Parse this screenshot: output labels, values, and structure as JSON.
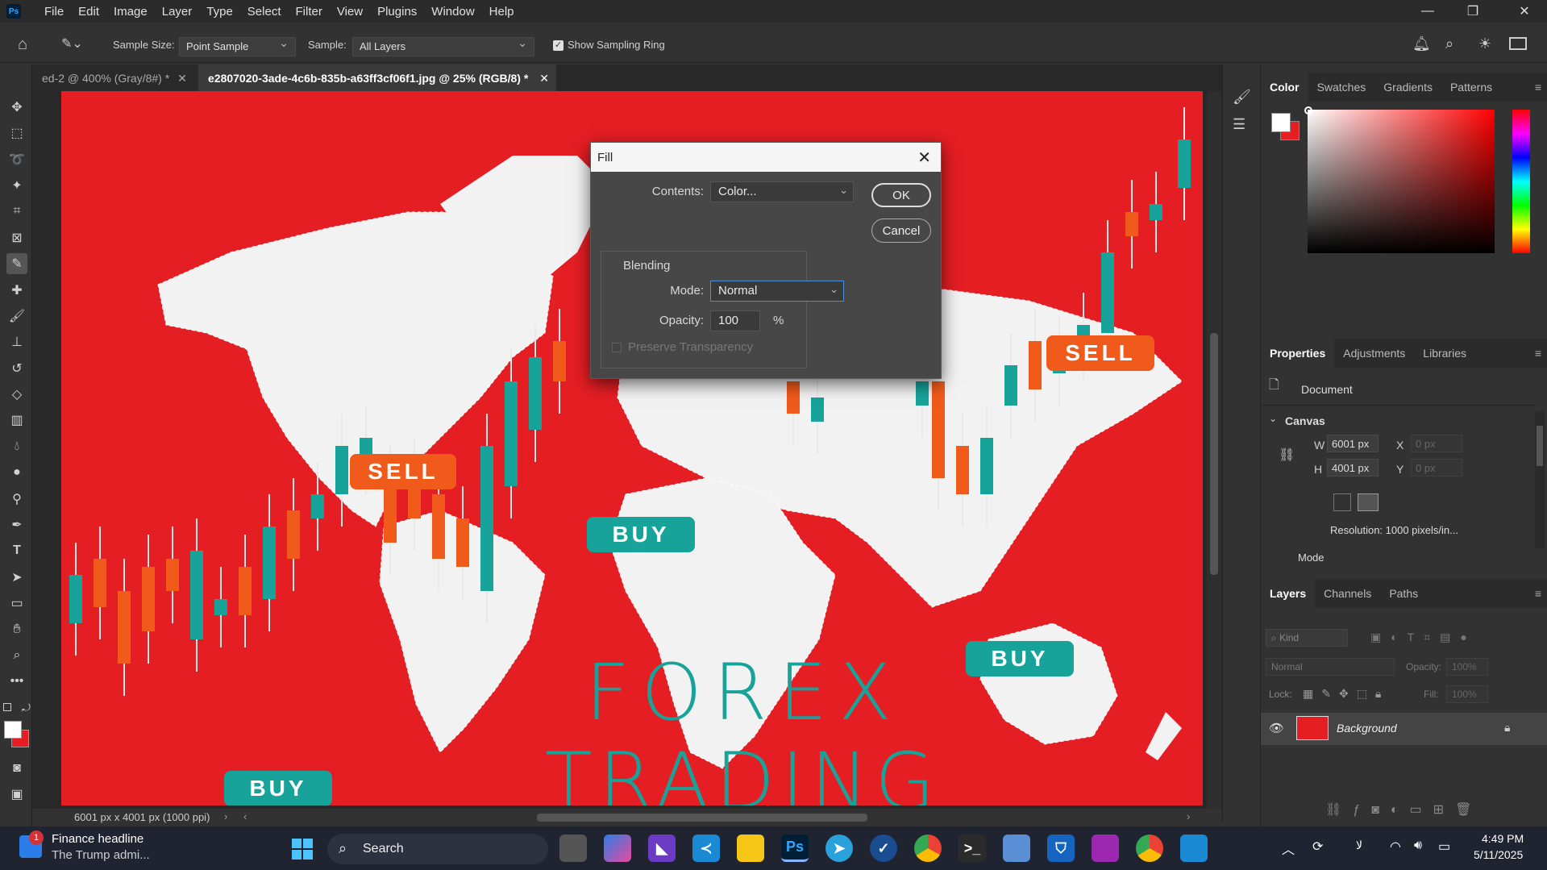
{
  "app": {
    "logo": "Ps",
    "menu": [
      "File",
      "Edit",
      "Image",
      "Layer",
      "Type",
      "Select",
      "Filter",
      "View",
      "Plugins",
      "Window",
      "Help"
    ]
  },
  "options": {
    "sample_size_label": "Sample Size:",
    "sample_size_value": "Point Sample",
    "sample_label": "Sample:",
    "sample_value": "All Layers",
    "show_ring_label": "Show Sampling Ring",
    "show_ring_checked": true
  },
  "tabs": [
    {
      "label": "ed-2 @ 400% (Gray/8#) *",
      "active": false
    },
    {
      "label": "e2807020-3ade-4c6b-835b-a63ff3cf06f1.jpg @ 25% (RGB/8) *",
      "active": true
    }
  ],
  "artwork": {
    "sell_1": "SELL",
    "sell_2": "SELL",
    "buy_1": "BUY",
    "buy_2": "BUY",
    "buy_3": "BUY",
    "headline_1": "FOREX",
    "headline_2": "TRADING"
  },
  "fill_dialog": {
    "title": "Fill",
    "contents_label": "Contents:",
    "contents_value": "Color...",
    "ok": "OK",
    "cancel": "Cancel",
    "blending_title": "Blending",
    "mode_label": "Mode:",
    "mode_value": "Normal",
    "opacity_label": "Opacity:",
    "opacity_value": "100",
    "opacity_unit": "%",
    "preserve_label": "Preserve Transparency",
    "preserve_checked": false
  },
  "color_panel": {
    "tabs": [
      "Color",
      "Swatches",
      "Gradients",
      "Patterns"
    ],
    "foreground": "#ffffff",
    "background": "#e51e24"
  },
  "properties_panel": {
    "tabs": [
      "Properties",
      "Adjustments",
      "Libraries"
    ],
    "doc_label": "Document",
    "canvas_label": "Canvas",
    "w_label": "W",
    "w_value": "6001 px",
    "h_label": "H",
    "h_value": "4001 px",
    "x_label": "X",
    "x_placeholder": "0 px",
    "y_label": "Y",
    "y_placeholder": "0 px",
    "resolution": "Resolution: 1000 pixels/in...",
    "mode_label": "Mode"
  },
  "layers_panel": {
    "tabs": [
      "Layers",
      "Channels",
      "Paths"
    ],
    "kind_placeholder": "Kind",
    "blend_mode": "Normal",
    "opacity_label": "Opacity:",
    "opacity_value": "100%",
    "lock_label": "Lock:",
    "fill_label": "Fill:",
    "fill_value": "100%",
    "layers": [
      {
        "name": "Background",
        "visible": true,
        "locked": true
      }
    ]
  },
  "status": {
    "doc_info": "6001 px x 4001 px (1000 ppi)"
  },
  "taskbar": {
    "news_badge": "1",
    "news_title": "Finance headline",
    "news_subtitle": "The Trump admi...",
    "search_label": "Search",
    "time": "4:49 PM",
    "date": "5/11/2025"
  },
  "colors": {
    "canvas_red": "#e51e24",
    "teal": "#17a39a",
    "orange": "#f05a1a",
    "map_white": "#f2f2f2"
  }
}
